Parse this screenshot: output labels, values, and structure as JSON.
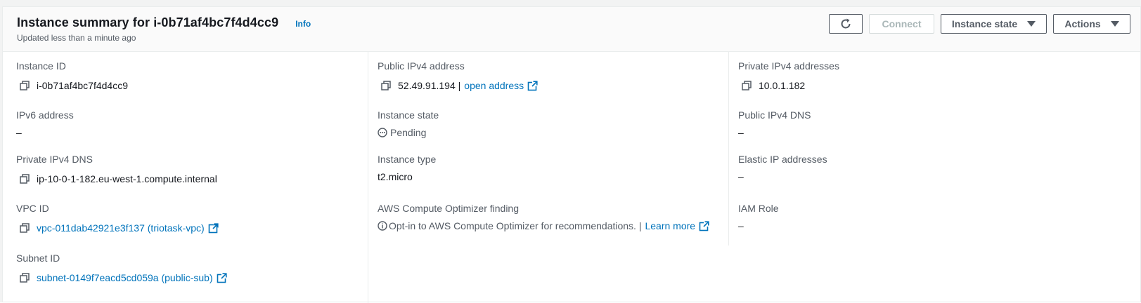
{
  "header": {
    "title_prefix": "Instance summary for",
    "instance_id": "i-0b71af4bc7f4d4cc9",
    "info_label": "Info",
    "subtitle": "Updated less than a minute ago"
  },
  "toolbar": {
    "refresh_icon": "refresh-icon",
    "connect_label": "Connect",
    "instance_state_label": "Instance state",
    "actions_label": "Actions"
  },
  "fields": {
    "instance_id": {
      "label": "Instance ID",
      "value": "i-0b71af4bc7f4d4cc9"
    },
    "ipv6_address": {
      "label": "IPv6 address",
      "value": "–"
    },
    "private_ipv4_dns": {
      "label": "Private IPv4 DNS",
      "value": "ip-10-0-1-182.eu-west-1.compute.internal"
    },
    "vpc_id": {
      "label": "VPC ID",
      "value": "vpc-011dab42921e3f137 (triotask-vpc)"
    },
    "subnet_id": {
      "label": "Subnet ID",
      "value": "subnet-0149f7eacd5cd059a (public-sub)"
    },
    "public_ipv4_address": {
      "label": "Public IPv4 address",
      "value": "52.49.91.194 |",
      "link": "open address"
    },
    "instance_state": {
      "label": "Instance state",
      "value": "Pending"
    },
    "instance_type": {
      "label": "Instance type",
      "value": "t2.micro"
    },
    "compute_optimizer": {
      "label": "AWS Compute Optimizer finding",
      "value": "Opt-in to AWS Compute Optimizer for recommendations. |",
      "link": "Learn more"
    },
    "private_ipv4_addresses": {
      "label": "Private IPv4 addresses",
      "value": "10.0.1.182"
    },
    "public_ipv4_dns": {
      "label": "Public IPv4 DNS",
      "value": "–"
    },
    "elastic_ip_addresses": {
      "label": "Elastic IP addresses",
      "value": "–"
    },
    "iam_role": {
      "label": "IAM Role",
      "value": "–"
    }
  },
  "colors": {
    "link": "#0073bb",
    "label": "#545b64",
    "text": "#16191f",
    "divider": "#eaeded",
    "disabled": "#aab7b8"
  }
}
